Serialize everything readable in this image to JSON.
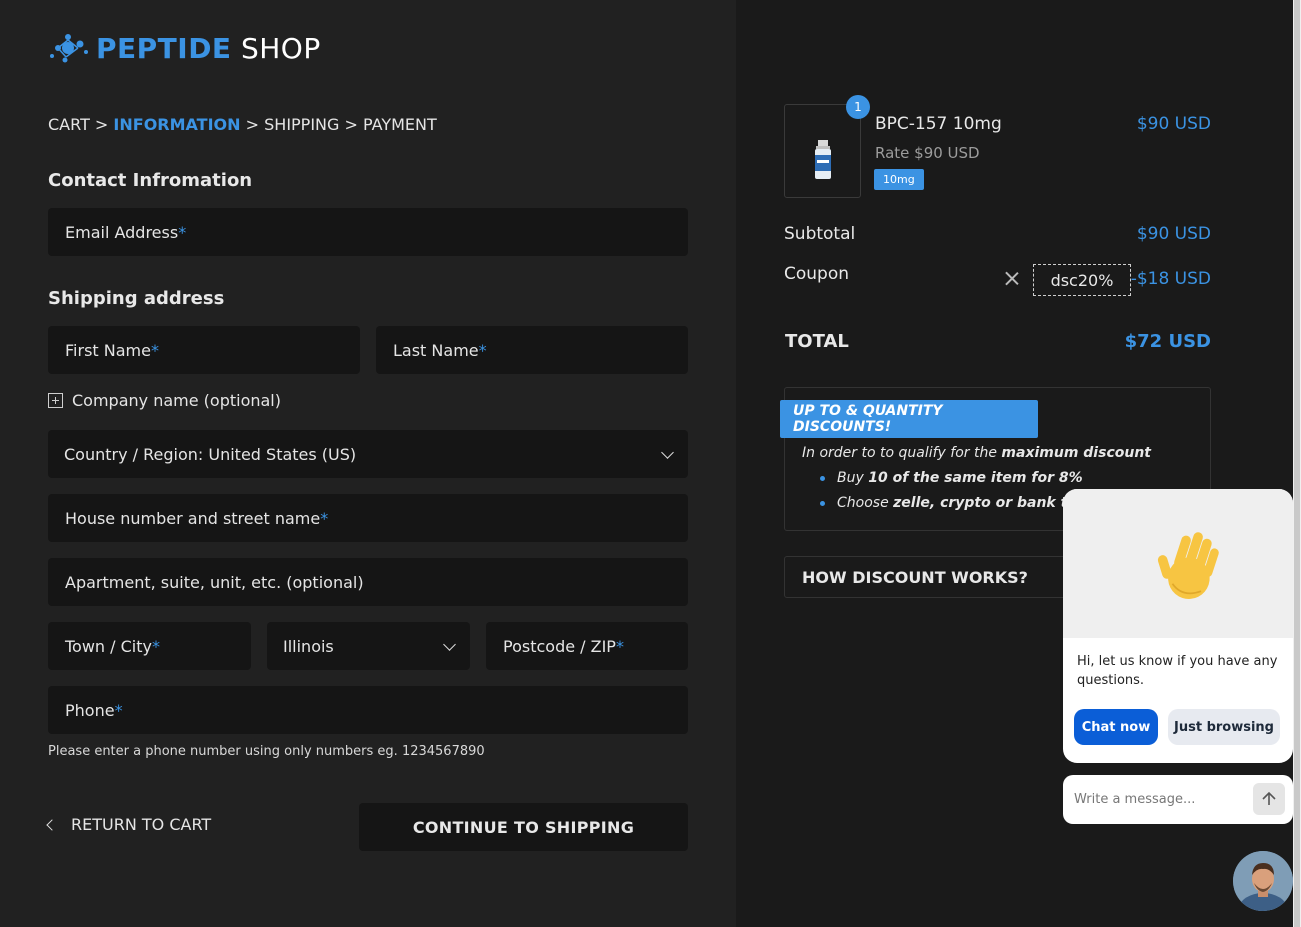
{
  "logo": {
    "brand": "PEPTIDE",
    "suffix": " SHOP"
  },
  "breadcrumb": {
    "cart": "CART",
    "sep1": " > ",
    "information": "INFORMATION",
    "sep2": " > ",
    "shipping": "SHIPPING",
    "sep3": " > ",
    "payment": "PAYMENT"
  },
  "contact": {
    "title": "Contact Infromation",
    "email_label": "Email Address",
    "required_mark": "*"
  },
  "shipping": {
    "title": "Shipping address",
    "first_name": "First Name",
    "last_name": "Last Name",
    "company_toggle": "Company name (optional)",
    "country": "Country / Region: United States (US)",
    "street": "House number and street name",
    "apartment": "Apartment, suite, unit, etc. (optional)",
    "city": "Town / City",
    "state": "Illinois",
    "postcode": "Postcode / ZIP",
    "phone": "Phone",
    "phone_hint": "Please enter a phone number using only numbers eg. 1234567890"
  },
  "actions": {
    "return_label": "RETURN TO CART",
    "continue_label": "CONTINUE TO SHIPPING"
  },
  "order": {
    "item": {
      "quantity": "1",
      "name": "BPC-157 10mg",
      "rate": "Rate $90 USD",
      "tag": "10mg",
      "price": "$90 USD"
    },
    "subtotal_label": "Subtotal",
    "subtotal_value": "$90 USD",
    "coupon_label": "Coupon",
    "coupon_code": "dsc20%",
    "coupon_value": "-$18 USD",
    "total_label": "TOTAL",
    "total_value": "$72 USD"
  },
  "discounts": {
    "heading": "UP TO & QUANTITY DISCOUNTS!",
    "intro": "In order to to qualify for the ",
    "intro_bold": "maximum discount",
    "item1_pre": "Buy ",
    "item1_bold": "10 of the same item for 8%",
    "item2_pre": "Choose ",
    "item2_bold": "zelle, crypto or bank tra",
    "how_label": "HOW DISCOUNT WORKS?"
  },
  "chat": {
    "message": "Hi, let us know if you have any questions.",
    "chat_now": "Chat now",
    "just_browsing": "Just browsing",
    "input_placeholder": "Write a message..."
  },
  "colors": {
    "accent": "#3b93e3",
    "panel_left": "#212121",
    "panel_right": "#1a1a1a",
    "field": "#151515",
    "chat_primary": "#0b5ed7"
  }
}
